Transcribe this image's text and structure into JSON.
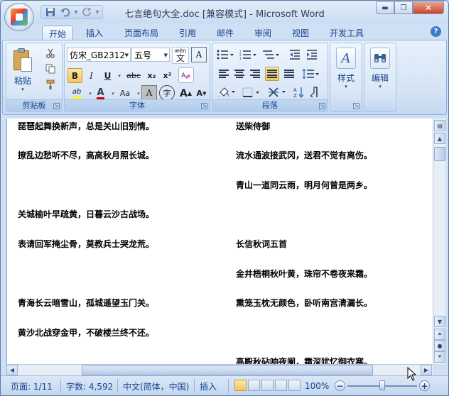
{
  "window": {
    "title": "七言绝句大全.doc [兼容模式] - Microsoft Word"
  },
  "qat": {
    "save_icon": "save-icon",
    "undo_icon": "undo-icon",
    "redo_icon": "redo-icon"
  },
  "tabs": [
    {
      "label": "开始"
    },
    {
      "label": "插入"
    },
    {
      "label": "页面布局"
    },
    {
      "label": "引用"
    },
    {
      "label": "邮件"
    },
    {
      "label": "审阅"
    },
    {
      "label": "视图"
    },
    {
      "label": "开发工具"
    }
  ],
  "ribbon": {
    "clipboard": {
      "label": "剪贴板",
      "paste_label": "粘贴"
    },
    "font": {
      "label": "字体",
      "font_name": "仿宋_GB2312",
      "font_size": "五号",
      "bold": "B",
      "italic": "I",
      "underline": "U",
      "strike": "abc",
      "subscript": "x₂",
      "superscript": "x²",
      "case": "Aa",
      "grow": "A",
      "shrink": "A",
      "wen": "wén",
      "wen_char": "文",
      "font_color": "A",
      "highlight": "ab",
      "char_border": "A",
      "enclose": "字",
      "phonetic": "A",
      "color_red": "#e00000",
      "color_yellow": "#ffff00"
    },
    "paragraph": {
      "label": "段落"
    },
    "styles": {
      "label": "样式"
    },
    "editing": {
      "label": "编辑"
    }
  },
  "document": {
    "left_column": [
      "琵琶起舞换新声，总是关山旧别情。",
      "撩乱边愁听不尽，高高秋月照长城。",
      "关城榆叶早疏黄，日暮云沙古战场。",
      "表请回军掩尘骨，莫教兵士哭龙荒。",
      "青海长云暗雪山，孤城遥望玉门关。",
      "黄沙北战穿金甲，不破楼兰终不还。"
    ],
    "right_column": [
      "送柴侍御",
      "流水通波接武冈，送君不觉有离伤。",
      "青山一道同云雨，明月何曾是两乡。",
      "长信秋词五首",
      "金井梧桐秋叶黄，珠帘不卷夜来霜。",
      "熏笼玉枕无颜色，卧听南宫清漏长。",
      "高殿秋砧响夜阑，霜深犹忆御衣寒。"
    ]
  },
  "statusbar": {
    "page": "页面: 1/11",
    "words": "字数: 4,592",
    "language": "中文(简体，中国)",
    "mode": "插入",
    "zoom": "100%",
    "zoom_minus": "−",
    "zoom_plus": "+"
  },
  "colors": {
    "accent": "#15428b",
    "ribbon_bg": "#dbe7f6",
    "active_button": "#f7c45c"
  }
}
